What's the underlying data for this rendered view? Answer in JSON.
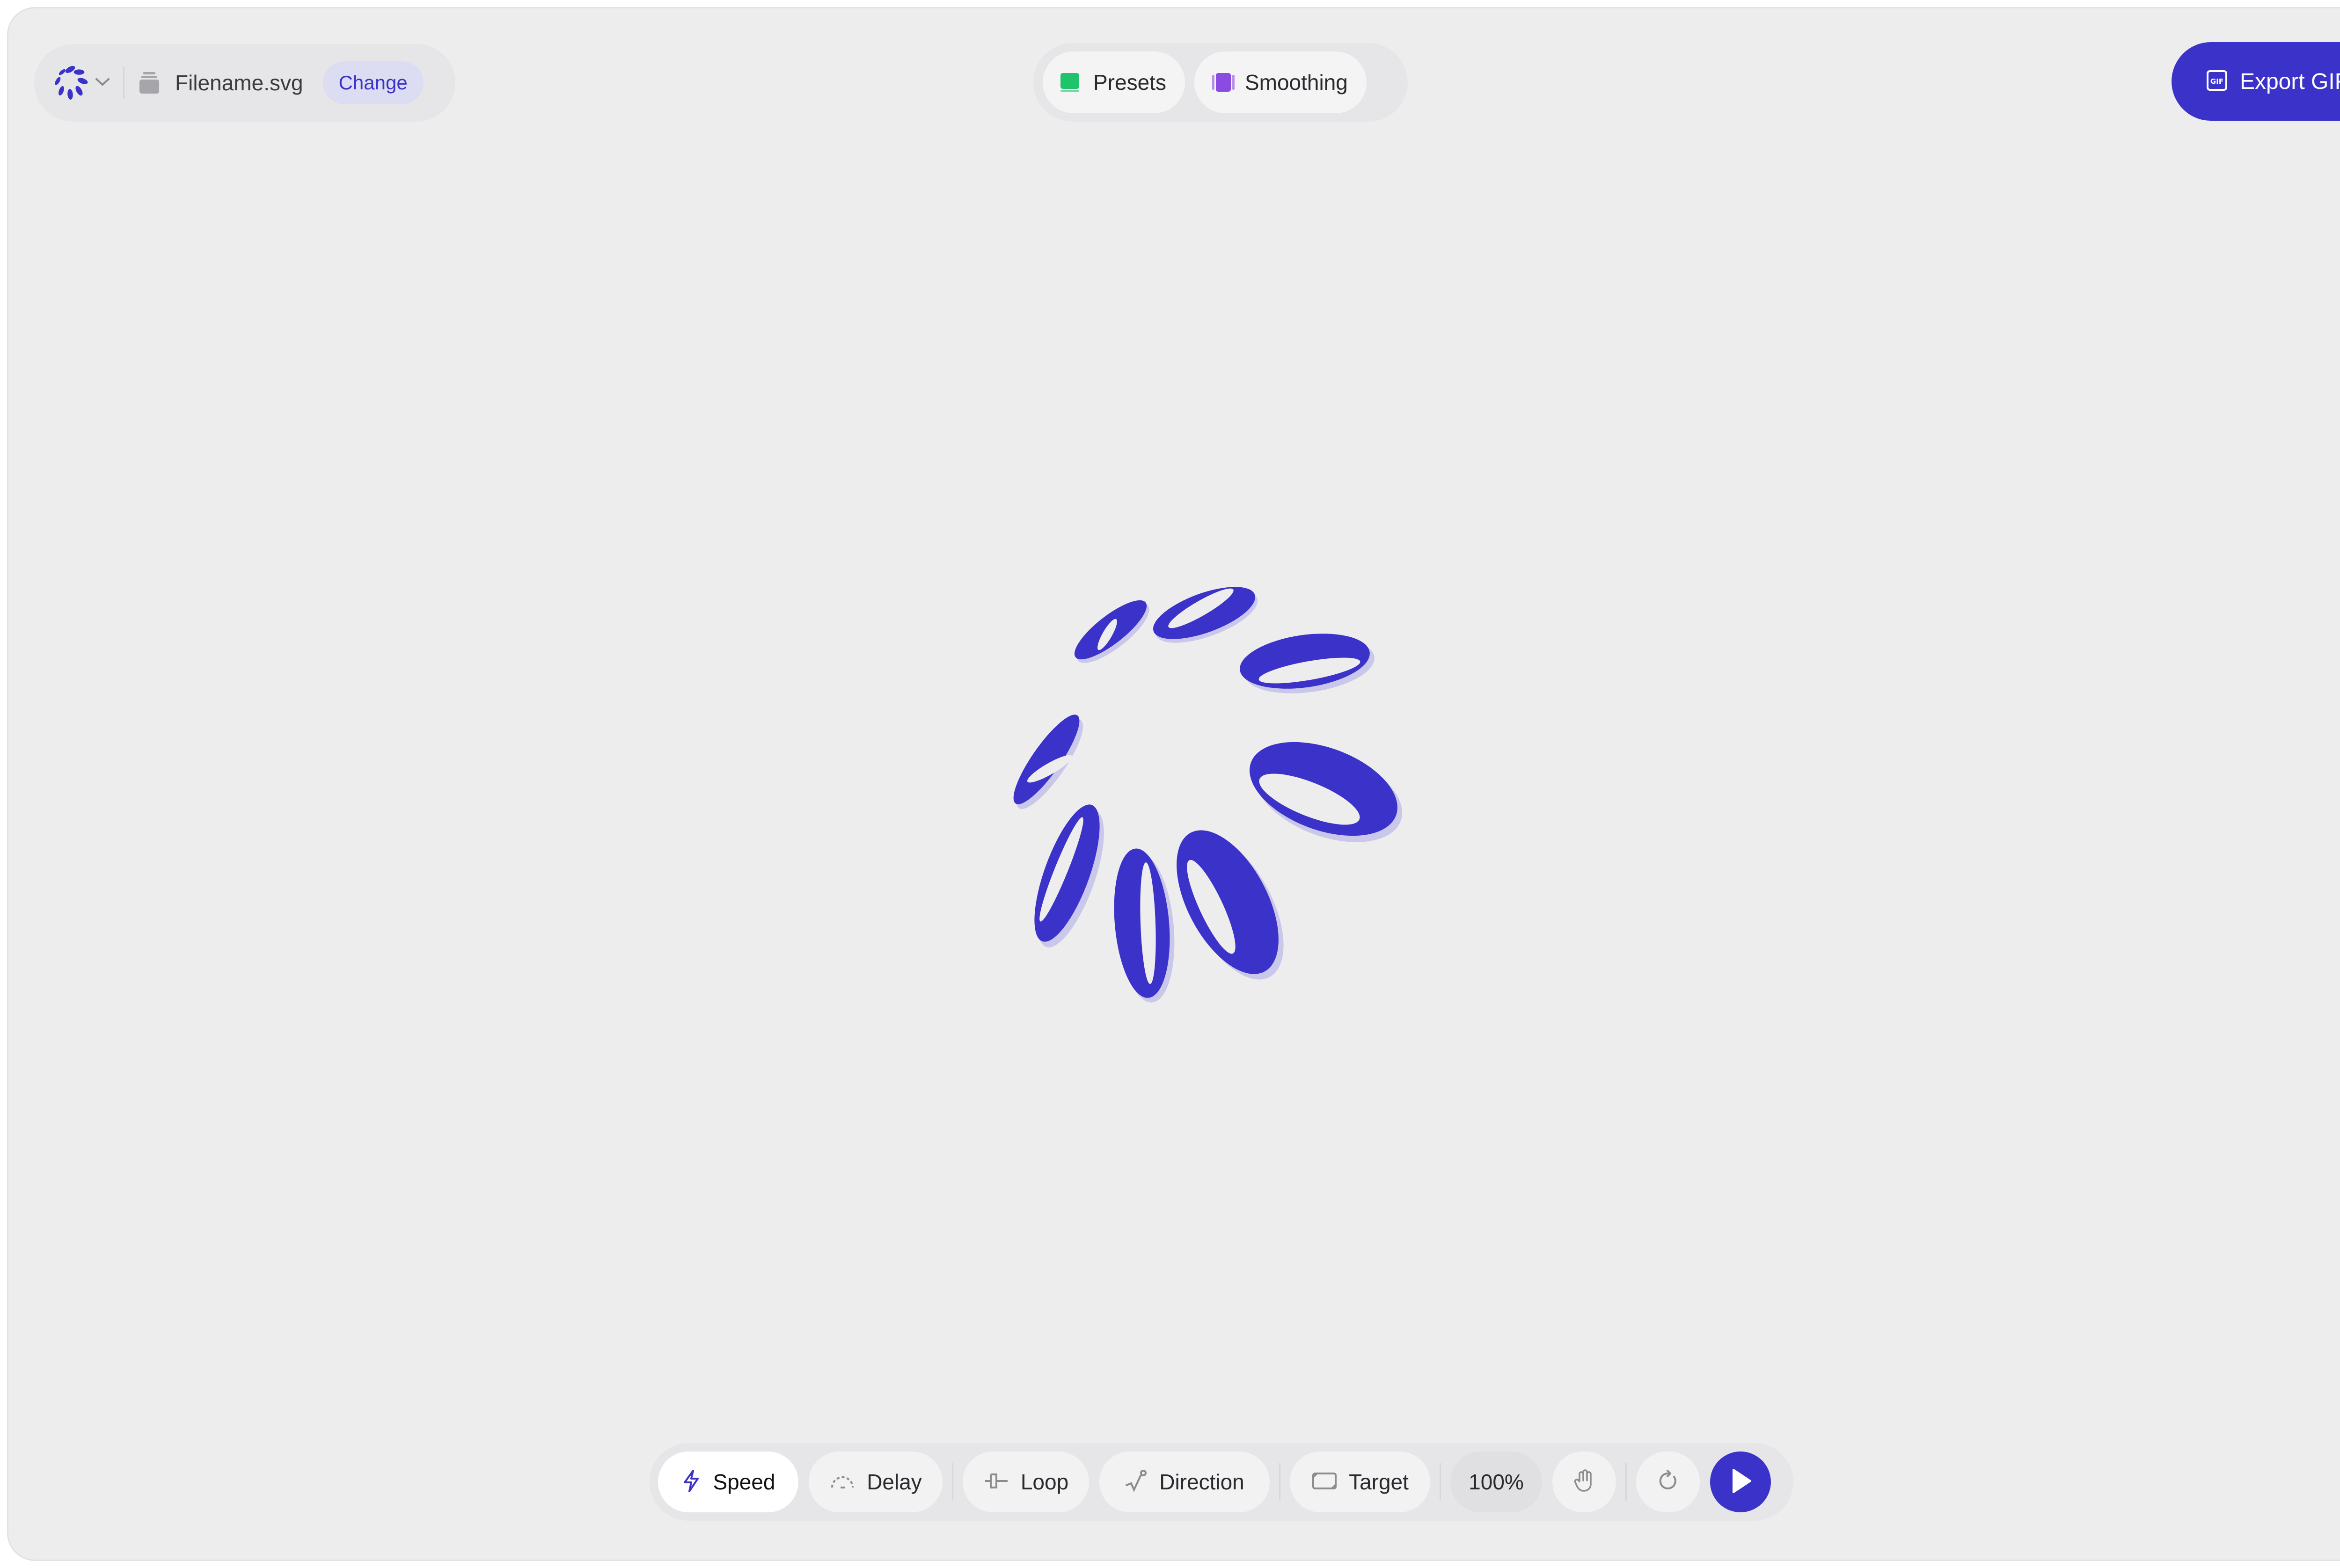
{
  "app": {
    "file_name": "Filename.svg",
    "change_label": "Change"
  },
  "top_center": {
    "presets_label": "Presets",
    "smoothing_label": "Smoothing",
    "presets_color": "#1ec36b",
    "smoothing_color": "#8a4be0"
  },
  "export": {
    "label": "Export GIF",
    "icon_text": "GIF"
  },
  "toolbar": {
    "speed": "Speed",
    "delay": "Delay",
    "loop": "Loop",
    "direction": "Direction",
    "target": "Target",
    "zoom": "100%"
  },
  "colors": {
    "accent": "#3b33c9",
    "shadow": "#c8c6ec",
    "background": "#ededed"
  },
  "icons": [
    "logo-spinner-icon",
    "chevron-down-icon",
    "file-stack-icon",
    "presets-square-icon",
    "smoothing-square-icon",
    "gif-icon",
    "bolt-icon",
    "delay-arc-icon",
    "loop-icon",
    "direction-icon",
    "target-frame-icon",
    "hand-icon",
    "reset-icon",
    "play-icon"
  ]
}
